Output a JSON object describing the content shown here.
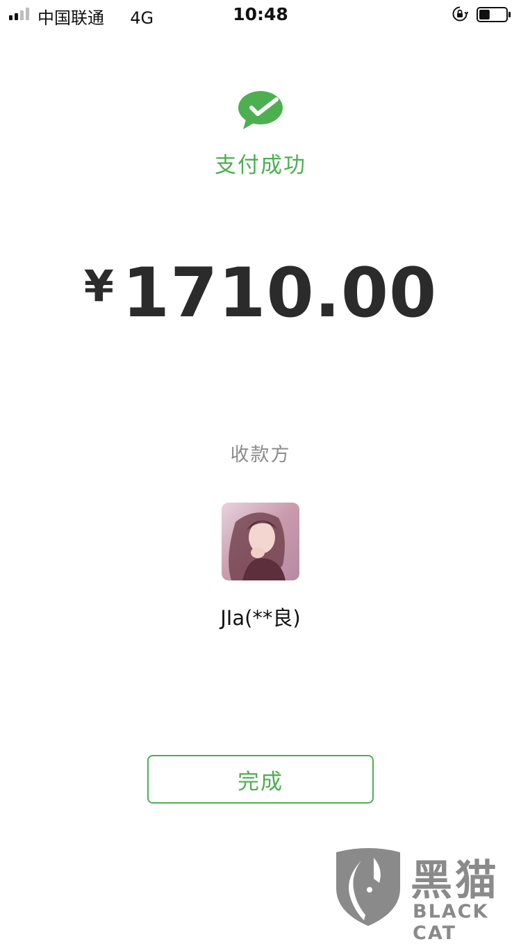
{
  "status_bar": {
    "carrier": "中国联通",
    "network": "4G",
    "time": "10:48",
    "signal_bars_active": 2,
    "signal_bars_total": 4,
    "battery_level": 0.4
  },
  "result": {
    "icon": "wechat-pay-check-icon",
    "title": "支付成功"
  },
  "payment": {
    "currency": "¥",
    "amount": "1710.00"
  },
  "payee": {
    "label": "收款方",
    "name": "JIa(**良)",
    "avatar": "avatar"
  },
  "actions": {
    "done_label": "完成"
  },
  "watermark": {
    "cn": "黑猫",
    "en": "BLACK CAT"
  },
  "colors": {
    "accent": "#4caf50",
    "text_dark": "#2b2b2b",
    "text_muted": "#8c8c8c",
    "watermark": "#8a8a8a"
  }
}
